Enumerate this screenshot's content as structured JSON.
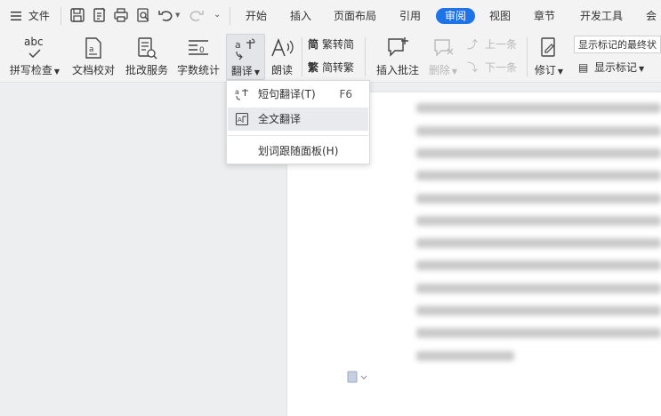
{
  "menubar": {
    "file_label": "文件",
    "tabs": [
      {
        "label": "开始"
      },
      {
        "label": "插入"
      },
      {
        "label": "页面布局"
      },
      {
        "label": "引用"
      },
      {
        "label": "审阅"
      },
      {
        "label": "视图"
      },
      {
        "label": "章节"
      },
      {
        "label": "开发工具"
      },
      {
        "label": "会"
      }
    ],
    "active_tab": "审阅"
  },
  "ribbon": {
    "spell_check": "拼写检查",
    "doc_proof": "文档校对",
    "revise_service": "批改服务",
    "word_count": "字数统计",
    "translate": "翻译",
    "read_aloud": "朗读",
    "trad_to_simp": "繁转简",
    "simp_to_trad": "简转繁",
    "insert_comment": "插入批注",
    "delete": "删除",
    "prev": "上一条",
    "next": "下一条",
    "track_changes": "修订",
    "show_markup_final": "显示标记的最终状",
    "show_markup": "显示标记",
    "spell_icon_text": "abc"
  },
  "dropdown": {
    "items": [
      {
        "label": "短句翻译(T)",
        "shortcut": "F6"
      },
      {
        "label": "全文翻译",
        "shortcut": ""
      },
      {
        "label": "划词跟随面板(H)",
        "shortcut": ""
      }
    ]
  },
  "colors": {
    "accent": "#1e73e8",
    "highlight": "#e8eaed"
  }
}
